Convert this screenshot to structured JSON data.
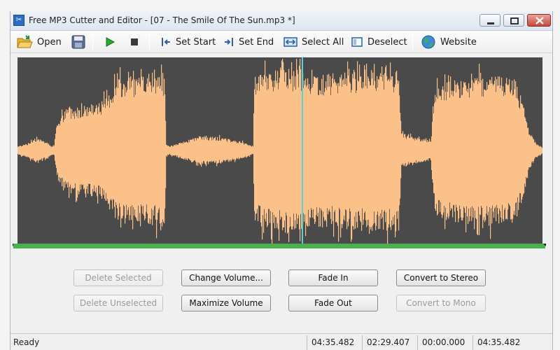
{
  "window": {
    "title": "Free MP3 Cutter and Editor - [07 - The Smile Of The Sun.mp3 *]"
  },
  "toolbar": {
    "open": "Open",
    "set_start": "Set Start",
    "set_end": "Set End",
    "select_all": "Select All",
    "deselect": "Deselect",
    "website": "Website"
  },
  "buttons": {
    "delete_selected": "Delete Selected",
    "change_volume": "Change Volume...",
    "fade_in": "Fade In",
    "convert_to_stereo": "Convert to Stereo",
    "delete_unselected": "Delete Unselected",
    "maximize_volume": "Maximize Volume",
    "fade_out": "Fade Out",
    "convert_to_mono": "Convert to Mono"
  },
  "status": {
    "text": "Ready",
    "time1": "04:35.482",
    "time2": "02:29.407",
    "time3": "00:00.000",
    "time4": "04:35.482"
  },
  "colors": {
    "waveform_bg": "#4a4a4a",
    "waveform_fill": "#fbc188",
    "cursor": "#4fd6d6",
    "timeline": "#49b24f"
  }
}
